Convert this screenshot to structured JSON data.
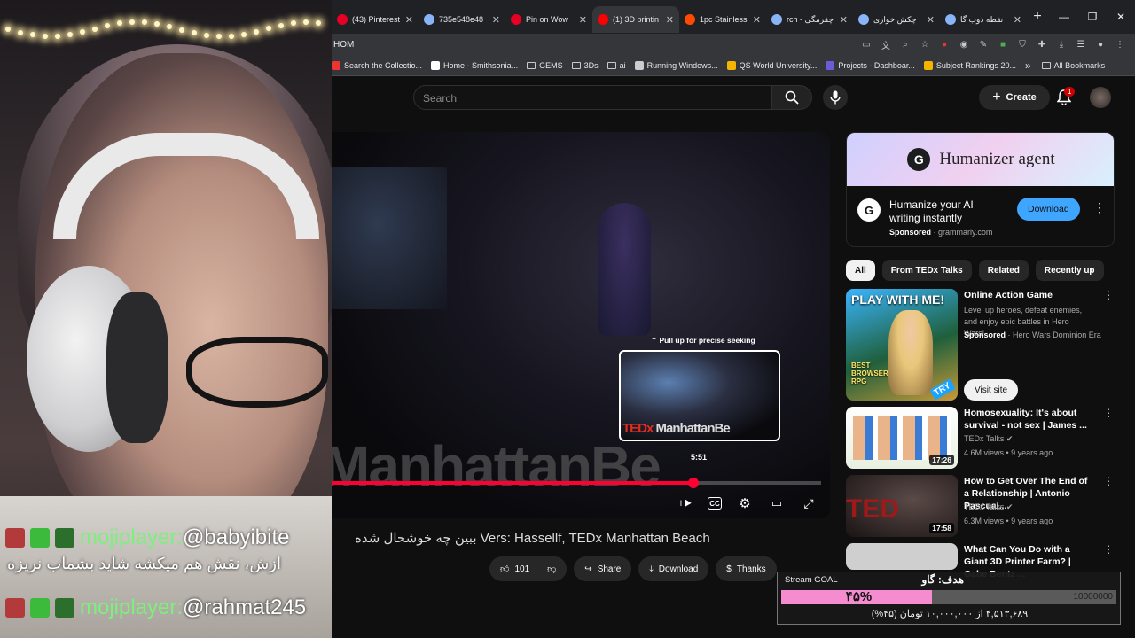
{
  "browser": {
    "tabs": [
      {
        "title": "(43) Pinterest",
        "icon_color": "#e60023",
        "active": false
      },
      {
        "title": "735e548e48",
        "icon_color": "#8ab4f8",
        "active": false
      },
      {
        "title": "Pin on Wow",
        "icon_color": "#e60023",
        "active": false
      },
      {
        "title": "(1) 3D printin",
        "icon_color": "#ff0000",
        "active": true
      },
      {
        "title": "1pc Stainless",
        "icon_color": "#ff4a00",
        "active": false
      },
      {
        "title": "rch - چقرمگی",
        "icon_color": "#8ab4f8",
        "active": false
      },
      {
        "title": "چکش خواری",
        "icon_color": "#8ab4f8",
        "active": false
      },
      {
        "title": "نقطه ذوب گا",
        "icon_color": "#8ab4f8",
        "active": false
      }
    ],
    "new_tab": "+",
    "url": "HOM",
    "bookmarks": [
      {
        "label": "Search the Collectio...",
        "icon_color": "#e33"
      },
      {
        "label": "Home - Smithsonia...",
        "icon_color": "#fff"
      },
      {
        "label": "GEMS",
        "icon_color": "folder"
      },
      {
        "label": "3Ds",
        "icon_color": "folder"
      },
      {
        "label": "ai",
        "icon_color": "folder"
      },
      {
        "label": "Running Windows...",
        "icon_color": "#ccc"
      },
      {
        "label": "QS World University...",
        "icon_color": "#f5b400"
      },
      {
        "label": "Projects - Dashboar...",
        "icon_color": "#6b5bd6"
      },
      {
        "label": "Subject Rankings 20...",
        "icon_color": "#f5b400"
      }
    ],
    "bookmarks_more": "»",
    "all_bookmarks": "All Bookmarks"
  },
  "youtube": {
    "search_placeholder": "Search",
    "create_label": "Create",
    "notification_count": "1"
  },
  "player": {
    "seek_hint": "⌃ Pull up for precise seeking",
    "preview_text_tedx": "TEDx",
    "preview_text_name": "ManhattanBe",
    "preview_time": "5:51",
    "watermark": "ManhattanBe",
    "progress_fraction": 0.74
  },
  "video": {
    "title": "ببین چه خوشحال شده Vers: Hassellf, TEDx Manhattan Beach",
    "like_count": "101",
    "share_label": "Share",
    "download_label": "Download",
    "thanks_label": "Thanks"
  },
  "ad": {
    "banner_title": "Humanizer agent",
    "headline": "Humanize your AI writing instantly",
    "sponsored": "Sponsored",
    "domain": "grammarly.com",
    "download_label": "Download"
  },
  "chips": [
    "All",
    "From TEDx Talks",
    "Related",
    "Recently up"
  ],
  "recommendations": [
    {
      "title": "Online Action Game",
      "desc": "Level up heroes, defeat enemies, and enjoy epic battles in Hero Wars!",
      "sponsored": "Sponsored",
      "advertiser": "Hero Wars Dominion Era",
      "cta": "Visit site",
      "thumb_text": "PLAY WITH ME!",
      "thumb_sub": "BEST BROWSER RPG",
      "thumb_tag": "TRY"
    },
    {
      "title": "Homosexuality: It's about survival - not sex | James ...",
      "channel": "TEDx Talks",
      "meta": "4.6M views • 9 years ago",
      "duration": "17:26"
    },
    {
      "title": "How to Get Over The End of a Relationship | Antonio Pascual...",
      "channel": "TEDx Talks",
      "meta": "6.3M views • 9 years ago",
      "duration": "17:58"
    },
    {
      "title": "What Can You Do with a Giant 3D Printer Farm? | Gabe Bentz ...",
      "channel": "",
      "meta": "",
      "duration": ""
    }
  ],
  "chat": [
    {
      "user": "mojiplayer:",
      "message": "@babyibite"
    },
    {
      "user": "",
      "message": "ازش، نقش هم میکشه شاید بشماب نریزه"
    },
    {
      "user": "mojiplayer:",
      "message": "@rahmat245"
    }
  ],
  "goal": {
    "label": "Stream GOAL",
    "title_fa": "هدف: گاو",
    "percent_label": "۴۵%",
    "max_label": "10000000",
    "fraction": 0.45,
    "summary": "۴,۵۱۳,۶۸۹ از ۱۰,۰۰۰,۰۰۰ تومان (۴۵%)"
  },
  "colors": {
    "youtube_red": "#ff0033",
    "goal_pink": "#f58ccf",
    "chat_user": "#7cf07c",
    "ad_button": "#3ea6ff"
  }
}
